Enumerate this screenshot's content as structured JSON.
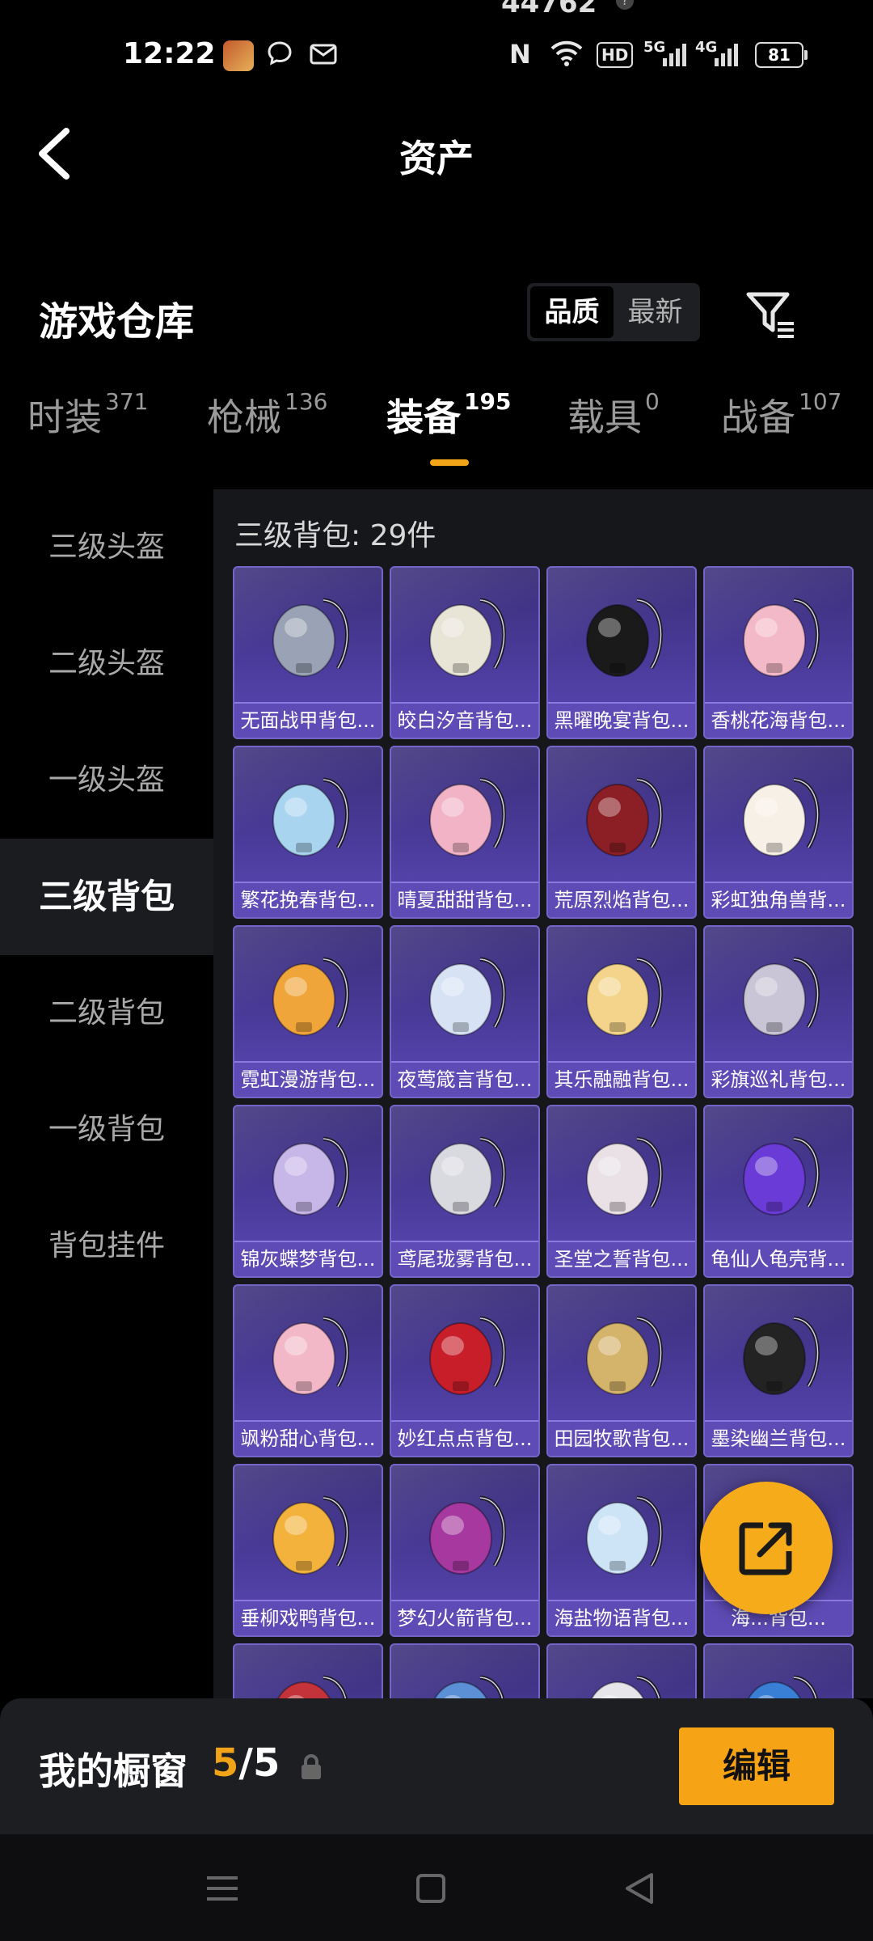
{
  "status_bar": {
    "top_number": "44762",
    "time": "12:22",
    "hd_label": "HD",
    "net_5g": "5G",
    "net_4g": "4G",
    "battery": "81"
  },
  "header": {
    "title": "资产"
  },
  "warehouse": {
    "title": "游戏仓库",
    "sort_options": [
      "品质",
      "最新"
    ],
    "active_sort": "品质"
  },
  "tabs": [
    {
      "label": "时装",
      "count": "371"
    },
    {
      "label": "枪械",
      "count": "136"
    },
    {
      "label": "装备",
      "count": "195"
    },
    {
      "label": "载具",
      "count": "0"
    },
    {
      "label": "战备",
      "count": "107"
    }
  ],
  "sidebar": {
    "items": [
      "三级头盔",
      "二级头盔",
      "一级头盔",
      "三级背包",
      "二级背包",
      "一级背包",
      "背包挂件"
    ],
    "active": "三级背包"
  },
  "section": {
    "title": "三级背包: 29件"
  },
  "items": [
    {
      "name": "无面战甲背包...",
      "icon": "armor-backpack-icon",
      "color": "#9aa3b5"
    },
    {
      "name": "皎白汐音背包...",
      "icon": "white-shell-backpack-icon",
      "color": "#e8e4d6"
    },
    {
      "name": "黑曜晚宴背包...",
      "icon": "dog-backpack-icon",
      "color": "#1a1a1a"
    },
    {
      "name": "香桃花海背包...",
      "icon": "pink-dress-backpack-icon",
      "color": "#f4b9c8"
    },
    {
      "name": "繁花挽春背包...",
      "icon": "flower-backpack-icon",
      "color": "#a9d4f0"
    },
    {
      "name": "晴夏甜甜背包...",
      "icon": "seashell-backpack-icon",
      "color": "#f2b3c6"
    },
    {
      "name": "荒原烈焰背包...",
      "icon": "red-tactical-backpack-icon",
      "color": "#8b1f25"
    },
    {
      "name": "彩虹独角兽背...",
      "icon": "unicorn-backpack-icon",
      "color": "#f7f0e6"
    },
    {
      "name": "霓虹漫游背包...",
      "icon": "neon-backpack-icon",
      "color": "#f0a53a"
    },
    {
      "name": "夜莺箴言背包...",
      "icon": "jellyfish-backpack-icon",
      "color": "#d7e3f5"
    },
    {
      "name": "其乐融融背包...",
      "icon": "bunny-ball-backpack-icon",
      "color": "#f3d48a"
    },
    {
      "name": "彩旗巡礼背包...",
      "icon": "star-disc-backpack-icon",
      "color": "#c9c4d6"
    },
    {
      "name": "锦灰蝶梦背包...",
      "icon": "butterfly-backpack-icon",
      "color": "#c7b6e8"
    },
    {
      "name": "鸢尾珑雾背包...",
      "icon": "iris-bag-backpack-icon",
      "color": "#d9d9e0"
    },
    {
      "name": "圣堂之誓背包...",
      "icon": "winged-backpack-icon",
      "color": "#e9e1e6"
    },
    {
      "name": "龟仙人龟壳背...",
      "icon": "turtle-shell-backpack-icon",
      "color": "#6a3bd6"
    },
    {
      "name": "飒粉甜心背包...",
      "icon": "pink-backpack-icon",
      "color": "#f3b8c8"
    },
    {
      "name": "妙红点点背包...",
      "icon": "ladybug-backpack-icon",
      "color": "#c81e2a"
    },
    {
      "name": "田园牧歌背包...",
      "icon": "basket-backpack-icon",
      "color": "#d4b36a"
    },
    {
      "name": "墨染幽兰背包...",
      "icon": "black-cylinder-backpack-icon",
      "color": "#232323"
    },
    {
      "name": "垂柳戏鸭背包...",
      "icon": "duck-backpack-icon",
      "color": "#f3b23c"
    },
    {
      "name": "梦幻火箭背包...",
      "icon": "rocket-backpack-icon",
      "color": "#a6389f"
    },
    {
      "name": "海盐物语背包...",
      "icon": "sailor-backpack-icon",
      "color": "#cde3f6"
    },
    {
      "name": "海...背包...",
      "icon": "teal-backpack-icon",
      "color": "#2bb5a6"
    },
    {
      "name": "",
      "icon": "red-backpack-icon",
      "color": "#c4323a"
    },
    {
      "name": "",
      "icon": "blue-tech-backpack-icon",
      "color": "#5b8fd6"
    },
    {
      "name": "",
      "icon": "white-wing-backpack-icon",
      "color": "#e6e6ea"
    },
    {
      "name": "",
      "icon": "blue-orb-backpack-icon",
      "color": "#3a7fd6"
    }
  ],
  "showcase": {
    "label": "我的橱窗",
    "current": "5",
    "total": "5",
    "edit_label": "编辑"
  },
  "colors": {
    "accent": "#f6a316",
    "card_bg": "#4a3b9a",
    "card_border": "#7565c9"
  }
}
